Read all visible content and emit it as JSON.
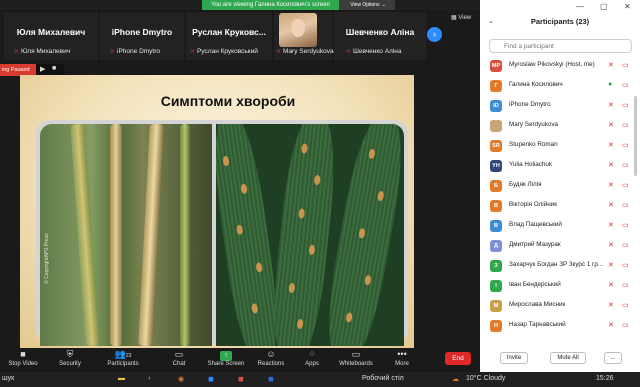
{
  "share_banner": "You are viewing Галина Косилович's screen",
  "view_options": "View Options",
  "view_options_caret": "⌄",
  "view_label": "View",
  "gallery": [
    {
      "name": "Юля Михалевич",
      "sub": "Юля Михалевич"
    },
    {
      "name": "iPhone Dmytro",
      "sub": "iPhone Dmytro"
    },
    {
      "name": "Руслан Круковс...",
      "sub": "Руслан Круковський"
    },
    {
      "name": "",
      "sub": "Mary Serdyukova"
    },
    {
      "name": "Шевченко Аліна",
      "sub": "Шевченко Аліна"
    }
  ],
  "recording": {
    "label": "ing Paused",
    "play": "▶",
    "stop": "■"
  },
  "slide": {
    "title": "Симптоми хвороби",
    "copyright": "© CopyrightAPS Press"
  },
  "sidebar": {
    "title": "Participants (23)",
    "search_placeholder": "Find a participant",
    "participants": [
      {
        "initials": "MP",
        "color": "#d94f3d",
        "name": "Myroslaw Pikovskyi (Host, me)"
      },
      {
        "initials": "Г",
        "color": "#e07b2b",
        "name": "Галина Косилович"
      },
      {
        "initials": "ID",
        "color": "#3f8cd6",
        "name": "iPhone Dmytro"
      },
      {
        "initials": "",
        "color": "#c9a57a",
        "name": "Mary Serdyukova"
      },
      {
        "initials": "SR",
        "color": "#e07b2b",
        "name": "Stupenko Roman"
      },
      {
        "initials": "YH",
        "color": "#2f4a7a",
        "name": "Yulia Holiachuk"
      },
      {
        "initials": "Б",
        "color": "#e07b2b",
        "name": "Будяк Лілія"
      },
      {
        "initials": "В",
        "color": "#e07b2b",
        "name": "Вікторія Олійник"
      },
      {
        "initials": "В",
        "color": "#3f8cd6",
        "name": "Влад Пащевський"
      },
      {
        "initials": "Д",
        "color": "#7f8fd6",
        "name": "Дмитрий Мазурак"
      },
      {
        "initials": "З",
        "color": "#2fa84f",
        "name": "Захарчук Богдан ЗР 3курс 1 гр..."
      },
      {
        "initials": "І",
        "color": "#2fa84f",
        "name": "Іван Бендерський"
      },
      {
        "initials": "М",
        "color": "#c8a24a",
        "name": "Мирослава Мисник"
      },
      {
        "initials": "Н",
        "color": "#e07b2b",
        "name": "Назар Тарнавський"
      }
    ],
    "invite": "Invite",
    "mute_all": "Mute All",
    "more": "..."
  },
  "toolbar": {
    "stop_video": "Stop Video",
    "security": "Security",
    "participants": "Participants",
    "participants_count": "23",
    "chat": "Chat",
    "share_screen": "Share Screen",
    "reactions": "Reactions",
    "apps": "Apps",
    "whiteboards": "Whiteboards",
    "more": "More",
    "end": "End"
  },
  "taskbar": {
    "search": "шук",
    "desktop": "Робочий стіл",
    "weather": "10°C Cloudy",
    "time": "15:26"
  },
  "colors": {
    "accent": "#2d8cff",
    "share_green": "#2fa84f",
    "end_red": "#e02828",
    "mute_red": "#d32f2f"
  }
}
